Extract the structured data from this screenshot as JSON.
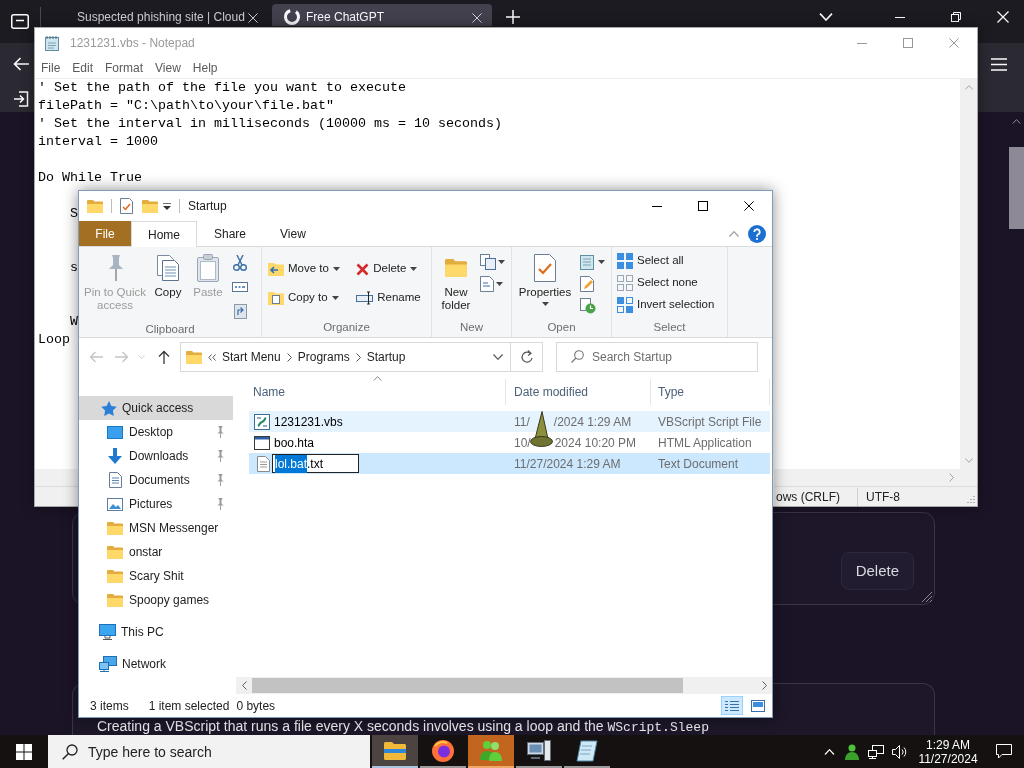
{
  "browser": {
    "tabs": [
      {
        "label": "Suspected phishing site | Cloud",
        "selected": false
      },
      {
        "label": "Free ChatGPT",
        "selected": true
      }
    ]
  },
  "page": {
    "delete_button": "Delete",
    "answer_text": "Creating a VBScript that runs a file every X seconds involves using a loop and the ",
    "answer_code": "WScript.Sleep"
  },
  "notepad": {
    "title": "1231231.vbs - Notepad",
    "menu": [
      "File",
      "Edit",
      "Format",
      "View",
      "Help"
    ],
    "lines": [
      {
        "kind": "code",
        "text": "' Set the path of the file you want to execute"
      },
      {
        "kind": "code",
        "text": "filePath = \"C:\\path\\to\\your\\file.bat\""
      },
      {
        "kind": "code",
        "text": "' Set the interval in milliseconds (10000 ms = 10 seconds)"
      },
      {
        "kind": "code",
        "text": "interval = 1000"
      },
      {
        "kind": "blank"
      },
      {
        "kind": "code",
        "text": "Do While True"
      },
      {
        "kind": "blank"
      },
      {
        "kind": "indent",
        "text": "S"
      },
      {
        "kind": "blank"
      },
      {
        "kind": "blank"
      },
      {
        "kind": "indent",
        "text": "s"
      },
      {
        "kind": "blank"
      },
      {
        "kind": "blank"
      },
      {
        "kind": "indent",
        "text": "W"
      },
      {
        "kind": "code",
        "text": "Loop"
      }
    ],
    "status": [
      "ows (CRLF)",
      "UTF-8"
    ]
  },
  "explorer": {
    "title": "Startup",
    "tabs": [
      {
        "label": "File",
        "kind": "file",
        "selected": false
      },
      {
        "label": "Home",
        "kind": "tab",
        "selected": true
      },
      {
        "label": "Share",
        "kind": "tab",
        "selected": false
      },
      {
        "label": "View",
        "kind": "tab",
        "selected": false
      }
    ],
    "ribbon": {
      "clipboard": {
        "label": "Clipboard",
        "pin": {
          "label": "Pin to Quick access",
          "disabled": true
        },
        "copy": {
          "label": "Copy",
          "disabled": false
        },
        "paste": {
          "label": "Paste",
          "disabled": true
        }
      },
      "organize": {
        "label": "Organize",
        "move_to": "Move to",
        "copy_to": "Copy to",
        "delete": "Delete",
        "rename": "Rename"
      },
      "new": {
        "label": "New",
        "new_folder": "New folder"
      },
      "open": {
        "label": "Open",
        "properties": "Properties"
      },
      "select": {
        "label": "Select",
        "select_all": "Select all",
        "select_none": "Select none",
        "invert_selection": "Invert selection"
      }
    },
    "nav": {
      "back": {
        "disabled": true
      },
      "forward": {
        "disabled": true
      },
      "up": {
        "disabled": false
      }
    },
    "address": [
      "Start Menu",
      "Programs",
      "Startup"
    ],
    "search": {
      "placeholder": "Search Startup"
    },
    "sidebar": [
      {
        "kind": "quick_access",
        "label": "Quick access",
        "selected": true,
        "children": [
          {
            "kind": "desktop",
            "label": "Desktop",
            "pinned": true,
            "selected": false
          },
          {
            "kind": "downloads",
            "label": "Downloads",
            "pinned": true,
            "selected": false
          },
          {
            "kind": "documents",
            "label": "Documents",
            "pinned": true,
            "selected": false
          },
          {
            "kind": "pictures",
            "label": "Pictures",
            "pinned": true,
            "selected": false
          },
          {
            "kind": "folder",
            "label": "MSN Messenger",
            "pinned": false,
            "selected": false
          },
          {
            "kind": "folder",
            "label": "onstar",
            "pinned": false,
            "selected": false
          },
          {
            "kind": "folder",
            "label": "Scary Shit",
            "pinned": false,
            "selected": false
          },
          {
            "kind": "folder",
            "label": "Spoopy games",
            "pinned": false,
            "selected": false
          }
        ]
      },
      {
        "kind": "this_pc",
        "label": "This PC",
        "selected": false
      },
      {
        "kind": "network",
        "label": "Network",
        "selected": false
      }
    ],
    "columns": [
      {
        "label": "Name",
        "sorted": true
      },
      {
        "label": "Date modified",
        "sorted": false
      },
      {
        "label": "Type",
        "sorted": false
      }
    ],
    "files": [
      {
        "kind": "vbs",
        "name": "1231231.vbs",
        "date_start": "11/",
        "date_end": "/2024 1:29 AM",
        "type": "VBScript Script File",
        "selected": false,
        "hover": true,
        "renaming": false
      },
      {
        "kind": "hta",
        "name": "boo.hta",
        "date_start": "10/",
        "date_end": "2024 10:20 PM",
        "type": "HTML Application",
        "selected": false,
        "hover": false,
        "renaming": false
      },
      {
        "kind": "txt",
        "name_selected": "lol.bat",
        "name_rest": ".txt",
        "date": "11/27/2024 1:29 AM",
        "type": "Text Document",
        "selected": true,
        "hover": false,
        "renaming": true
      }
    ],
    "status": {
      "count": "3 items",
      "selection": "1 item selected",
      "size": "0 bytes"
    },
    "views": [
      {
        "kind": "details",
        "selected": true
      },
      {
        "kind": "large_icons",
        "selected": false
      }
    ]
  },
  "taskbar": {
    "search": {
      "placeholder": "Type here to search"
    },
    "apps": [
      {
        "kind": "explorer",
        "selected": true,
        "flashing": false
      },
      {
        "kind": "browser",
        "selected": false,
        "flashing": false
      },
      {
        "kind": "messenger",
        "selected": false,
        "flashing": true
      },
      {
        "kind": "computer",
        "selected": false,
        "flashing": false
      },
      {
        "kind": "notepad",
        "selected": false,
        "flashing": false
      }
    ],
    "clock": {
      "time": "1:29 AM",
      "date": "11/27/2024"
    }
  }
}
